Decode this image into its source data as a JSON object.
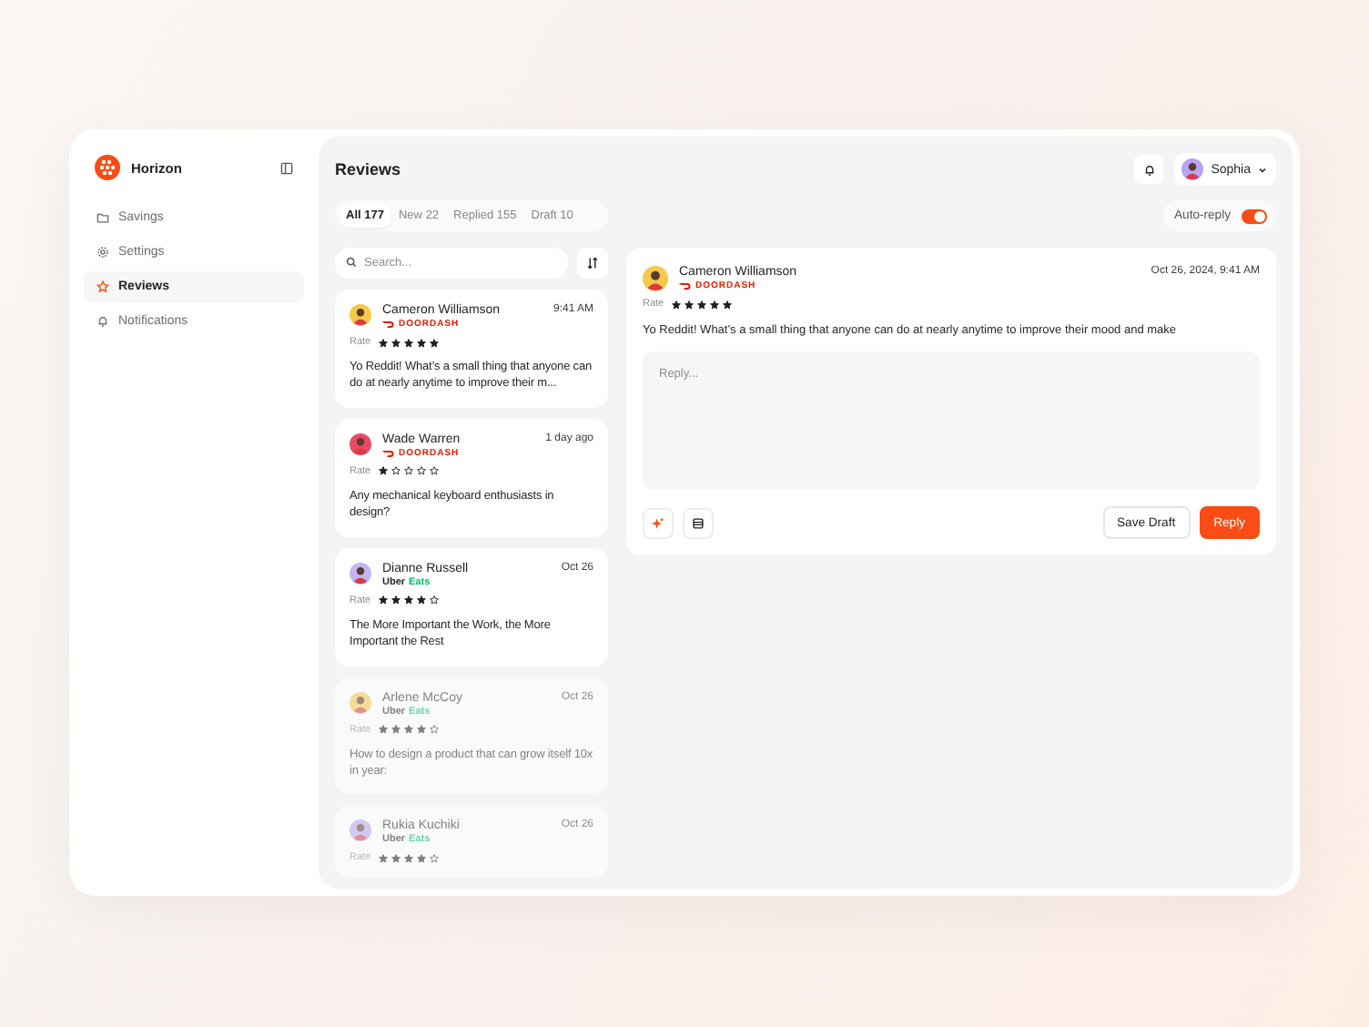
{
  "brand": {
    "name": "Horizon"
  },
  "sidebar": {
    "items": [
      {
        "label": "Savings",
        "selected": false
      },
      {
        "label": "Settings",
        "selected": false
      },
      {
        "label": "Reviews",
        "selected": true
      },
      {
        "label": "Notifications",
        "selected": false
      }
    ]
  },
  "header": {
    "title": "Reviews",
    "user": "Sophia"
  },
  "tabs": [
    {
      "label": "All",
      "count": "177",
      "selected": true
    },
    {
      "label": "New",
      "count": "22",
      "selected": false
    },
    {
      "label": "Replied",
      "count": "155",
      "selected": false
    },
    {
      "label": "Draft",
      "count": "10",
      "selected": false
    }
  ],
  "search": {
    "placeholder": "Search..."
  },
  "auto_reply": {
    "label": "Auto-reply",
    "on": true
  },
  "reviews": [
    {
      "name": "Cameron Williamson",
      "time": "9:41 AM",
      "platform": {
        "kind": "doordash",
        "label": "DOORDASH"
      },
      "rate_label": "Rate",
      "stars": 5,
      "text": "Yo Reddit! What’s a small thing that anyone can do at nearly anytime to improve their m...",
      "dimmed": false
    },
    {
      "name": "Wade Warren",
      "time": "1 day ago",
      "platform": {
        "kind": "doordash",
        "label": "DOORDASH"
      },
      "rate_label": "Rate",
      "stars": 1,
      "text": "Any mechanical keyboard enthusiasts in design?",
      "dimmed": false
    },
    {
      "name": "Dianne Russell",
      "time": "Oct 26",
      "platform": {
        "kind": "ubereats",
        "label": "Uber",
        "accent": "Eats"
      },
      "rate_label": "Rate",
      "stars": 4,
      "text": "The More Important the Work, the More Important the Rest",
      "dimmed": false
    },
    {
      "name": "Arlene McCoy",
      "time": "Oct 26",
      "platform": {
        "kind": "ubereats",
        "label": "Uber",
        "accent": "Eats"
      },
      "rate_label": "Rate",
      "stars": 4,
      "text": "How to design a product that can grow itself 10x in year:",
      "dimmed": true
    },
    {
      "name": "Rukia Kuchiki",
      "time": "Oct 26",
      "platform": {
        "kind": "ubereats",
        "label": "Uber",
        "accent": "Eats"
      },
      "rate_label": "Rate",
      "stars": 4,
      "dimmed": true
    }
  ],
  "detail": {
    "name": "Cameron Williamson",
    "time": "Oct 26, 2024, 9:41 AM",
    "platform": {
      "kind": "doordash",
      "label": "DOORDASH"
    },
    "rate_label": "Rate",
    "stars": 5,
    "text": "Yo Reddit! What’s a small thing that anyone can do at nearly anytime to improve their mood and make",
    "reply_placeholder": "Reply...",
    "buttons": [
      {
        "label": "Save Draft",
        "kind": "secondary"
      },
      {
        "label": "Reply",
        "kind": "primary"
      }
    ]
  }
}
